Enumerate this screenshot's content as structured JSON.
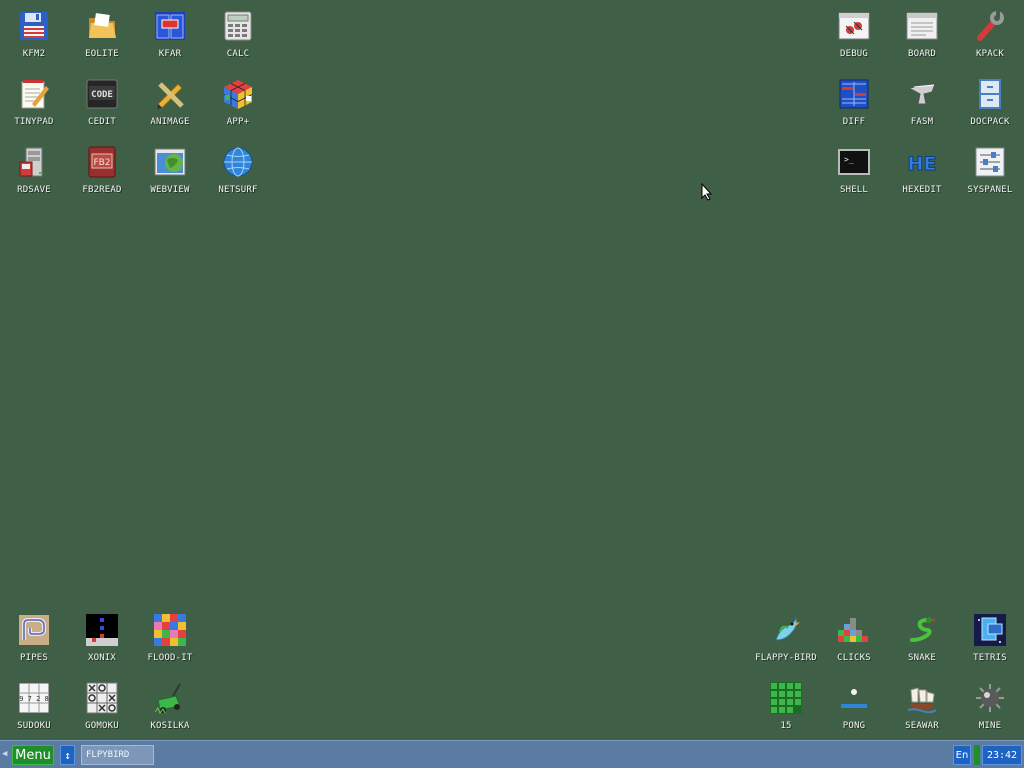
{
  "desktop": {
    "icons": {
      "kfm2": "KFM2",
      "eolite": "EOLITE",
      "kfar": "KFAR",
      "calc": "CALC",
      "tinypad": "TINYPAD",
      "cedit": "CEDIT",
      "animage": "ANIMAGE",
      "appplus": "APP+",
      "rdsave": "RDSAVE",
      "fb2read": "FB2READ",
      "webview": "WEBVIEW",
      "netsurf": "NETSURF",
      "debug": "DEBUG",
      "board": "BOARD",
      "kpack": "KPACK",
      "diff": "DIFF",
      "fasm": "FASM",
      "docpack": "DOCPACK",
      "shell": "SHELL",
      "hexedit": "HEXEDIT",
      "syspanel": "SYSPANEL",
      "pipes": "PIPES",
      "xonix": "XONIX",
      "floodit": "FLOOD-IT",
      "sudoku": "SUDOKU",
      "gomoku": "GOMOKU",
      "kosilka": "KOSILKA",
      "flappybird": "FLAPPY-BIRD",
      "clicks": "CLICKS",
      "snake": "SNAKE",
      "tetris": "TETRIS",
      "fifteen": "15",
      "pong": "PONG",
      "seawar": "SEAWAR",
      "mine": "MINE"
    },
    "icon_glyphs": {
      "cedit": "CODE",
      "fb2read": "FB2",
      "hexedit": "HE",
      "shell": ">_",
      "sudoku_digits": "9 7 2 8"
    }
  },
  "taskbar": {
    "menu_label": "Menu",
    "switch_glyph": "↕",
    "task_label": "FLPYBIRD",
    "lang": "En",
    "clock": "23:42"
  },
  "colors": {
    "desktop": "#3f5f47",
    "taskbar": "#5b7ba3",
    "menu_button": "#1f8f2a",
    "accent_blue": "#1e62c2"
  }
}
